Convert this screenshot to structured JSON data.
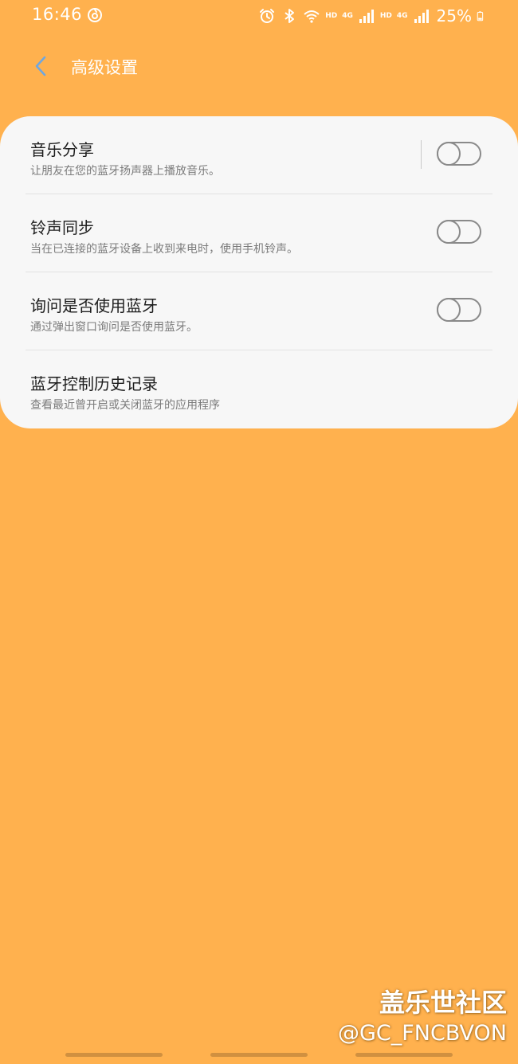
{
  "status_bar": {
    "time": "16:46",
    "app_icon": "netease-music-icon",
    "icons": [
      "alarm-icon",
      "bluetooth-icon",
      "wifi-icon",
      "signal-icon",
      "signal-icon"
    ],
    "hd_label_1": "HD",
    "hd_label_2": "HD",
    "network_1": "4G",
    "network_2": "4G",
    "battery_percent": "25%"
  },
  "header": {
    "back_icon": "chevron-left-icon",
    "title": "高级设置"
  },
  "settings": [
    {
      "title": "音乐分享",
      "subtitle": "让朋友在您的蓝牙扬声器上播放音乐。",
      "toggle": false
    },
    {
      "title": "铃声同步",
      "subtitle": "当在已连接的蓝牙设备上收到来电时，使用手机铃声。",
      "toggle": false
    },
    {
      "title": "询问是否使用蓝牙",
      "subtitle": "通过弹出窗口询问是否使用蓝牙。",
      "toggle": false
    },
    {
      "title": "蓝牙控制历史记录",
      "subtitle": "查看最近曾开启或关闭蓝牙的应用程序"
    }
  ],
  "watermark": {
    "site": "盖乐世社区",
    "handle": "@GC_FNCBVON"
  },
  "colors": {
    "background": "#FFB14E",
    "card": "#F7F7F7",
    "toggle_off": "#8A8A8A"
  }
}
